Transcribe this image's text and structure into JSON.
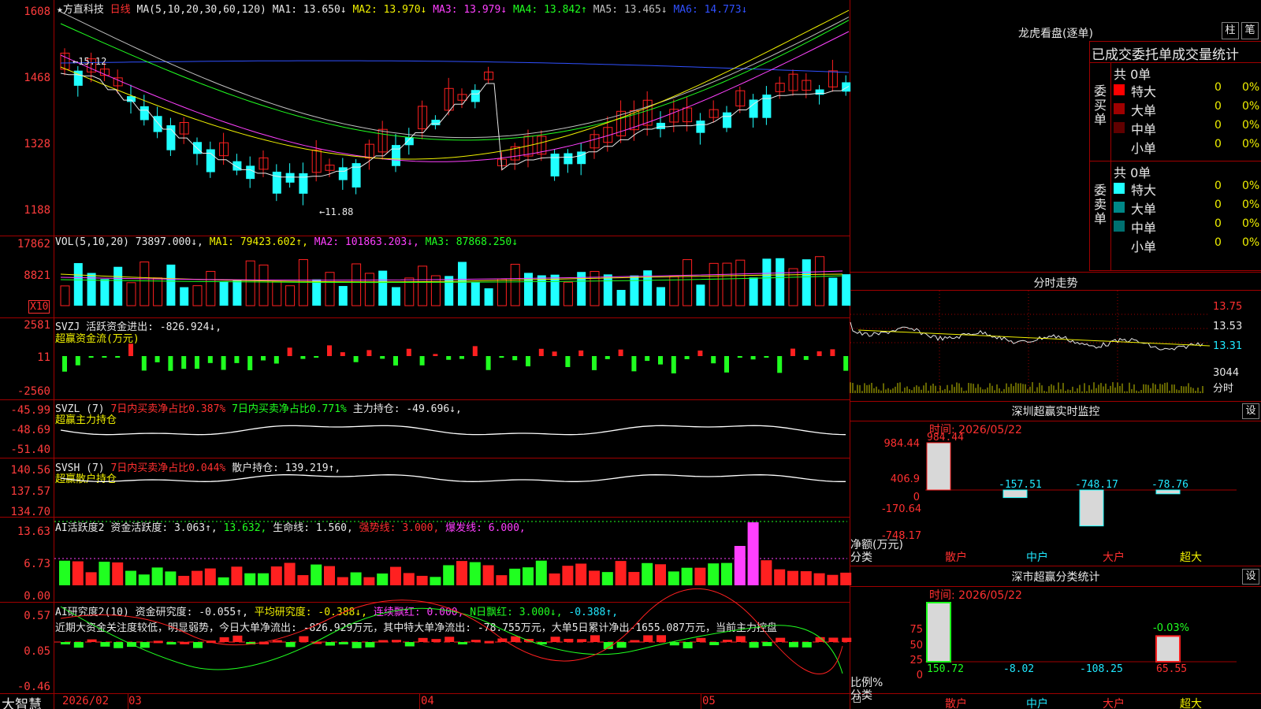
{
  "main_chart": {
    "title_star": "★",
    "stock_name": "方直科技",
    "period": "日线",
    "ma_params": "MA(5,10,20,30,60,120)",
    "ma_values": [
      {
        "label": "MA1:",
        "value": "13.650↓",
        "color": "#e8e8e8"
      },
      {
        "label": "MA2:",
        "value": "13.970↓",
        "color": "#f0f000"
      },
      {
        "label": "MA3:",
        "value": "13.979↓",
        "color": "#ff40ff"
      },
      {
        "label": "MA4:",
        "value": "13.842↑",
        "color": "#20ff20"
      },
      {
        "label": "MA5:",
        "value": "13.465↓",
        "color": "#c0c0c0"
      },
      {
        "label": "MA6:",
        "value": "14.773↓",
        "color": "#3050ff"
      }
    ],
    "y_ticks": [
      "1608",
      "1468",
      "1328",
      "1188"
    ],
    "high_marker": "←15.12",
    "low_marker": "←11.88"
  },
  "vol_chart": {
    "header": "VOL(5,10,20)",
    "value": "73897.000↓",
    "ma1": "MA1: 79423.602↑",
    "ma2": "MA2: 101863.203↓",
    "ma3": "MA3: 87868.250↓",
    "y_ticks": [
      "17862",
      "8821"
    ],
    "unit": "X10"
  },
  "svzj": {
    "line1": "SVZJ  活跃资金进出: -826.924↓,",
    "line2": "超赢资金流(万元)",
    "y_ticks": [
      "2581",
      "11",
      "-2560"
    ]
  },
  "svzl": {
    "name": "SVZL (7)",
    "p1": "7日内买卖净占比0.387%",
    "p2": "7日内买卖净占比0.771%",
    "p3": "主力持仓: -49.696↓,",
    "line2": "超赢主力持仓",
    "y_ticks": [
      "-45.99",
      "-48.69",
      "-51.40"
    ]
  },
  "svsh": {
    "name": "SVSH (7)",
    "p1": "7日内买卖净占比0.044%",
    "p2": "散户持仓: 139.219↑,",
    "line2": "超赢散户持仓",
    "y_ticks": [
      "140.56",
      "137.57",
      "134.70"
    ]
  },
  "ai_active": {
    "name": "AI活跃度2",
    "p1": "资金活跃度: 3.063↑,",
    "p2": "13.632,",
    "p3": "生命线: 1.560,",
    "p4": "强势线: 3.000,",
    "p5": "爆发线: 6.000,",
    "y_ticks": [
      "13.63",
      "6.73",
      "0.00"
    ]
  },
  "ai_research": {
    "name": "AI研究度2(10)",
    "p1": "资金研究度: -0.055↑,",
    "p2": "平均研究度: -0.388↓,",
    "p3": "连续飘红: 0.000,",
    "p4": "N日飘红: 3.000↓,",
    "p5": "-0.388↑,",
    "summary": "近期大资金关注度较低，明显弱势，今日大单净流出: -826.929万元，其中特大单净流出: -78.755万元，大单5日累计净出-1655.087万元，当前主力控盘",
    "y_ticks": [
      "0.57",
      "0.05",
      "-0.46"
    ]
  },
  "x_axis": {
    "brand": "大智慧",
    "labels": [
      "2026/02",
      "03",
      "04",
      "05"
    ]
  },
  "right_panel": {
    "title": "龙虎看盘(逐单)",
    "btn_pillar": "柱",
    "btn_pen": "笔",
    "stat_title": "已成交委托单成交量统计",
    "buy_label": "委买单",
    "sell_label": "委卖单",
    "buy_total": "共 0单",
    "sell_total": "共 0单",
    "buy_rows": [
      {
        "label": "特大",
        "count": "0",
        "pct": "0%",
        "color": "#ff0000"
      },
      {
        "label": "大单",
        "count": "0",
        "pct": "0%",
        "color": "#a00000"
      },
      {
        "label": "中单",
        "count": "0",
        "pct": "0%",
        "color": "#600000"
      },
      {
        "label": "小单",
        "count": "0",
        "pct": "0%",
        "color": ""
      }
    ],
    "sell_rows": [
      {
        "label": "特大",
        "count": "0",
        "pct": "0%",
        "color": "#20ffff"
      },
      {
        "label": "大单",
        "count": "0",
        "pct": "0%",
        "color": "#008888"
      },
      {
        "label": "中单",
        "count": "0",
        "pct": "0%",
        "color": "#007070"
      },
      {
        "label": "小单",
        "count": "0",
        "pct": "0%",
        "color": ""
      }
    ],
    "intraday_title": "分时走势",
    "intraday_ticks": [
      "13.75",
      "13.53",
      "13.31",
      "3044",
      "分时"
    ],
    "sz_monitor_title": "深圳超赢实时监控",
    "sz_monitor_btn": "设",
    "sz_time": "时间: 2026/05/22",
    "net_labels": [
      "984.44",
      "406.9",
      "0",
      "-170.64",
      "-748.17"
    ],
    "net_unit": "净额(万元)",
    "net_cat": "分类",
    "net_values": [
      {
        "label": "984.44",
        "value": 984.44
      },
      {
        "label": "-157.51",
        "value": -157.51
      },
      {
        "label": "-748.17",
        "value": -748.17
      },
      {
        "label": "-78.76",
        "value": -78.76
      }
    ],
    "categories": [
      "散户",
      "中户",
      "大户",
      "超大"
    ],
    "sz_class_title": "深市超赢分类统计",
    "sz_class_btn": "设",
    "class_time": "时间: 2026/05/22",
    "ratio_ticks": [
      "75",
      "50",
      "25",
      "0"
    ],
    "ratio_unit": "比例%",
    "ratio_cat": "分类",
    "ratio_values": [
      {
        "label": "150.72",
        "value": 150.72
      },
      {
        "label": "-8.02",
        "value": -8.02
      },
      {
        "label": "-108.25",
        "value": -108.25
      },
      {
        "label": "65.55",
        "value": 65.55
      }
    ],
    "ratio_top_label": "-0.03%"
  },
  "chart_data": {
    "type": "candlestick",
    "title": "方直科技 日线",
    "x_labels": [
      "2026/02",
      "03",
      "04",
      "05"
    ],
    "ylim": [
      11.88,
      16.08
    ],
    "high": 15.12,
    "low": 11.88,
    "series": [
      {
        "name": "MA1",
        "last": 13.65
      },
      {
        "name": "MA2",
        "last": 13.97
      },
      {
        "name": "MA3",
        "last": 13.979
      },
      {
        "name": "MA4",
        "last": 13.842
      },
      {
        "name": "MA5",
        "last": 13.465
      },
      {
        "name": "MA6",
        "last": 14.773
      }
    ]
  }
}
